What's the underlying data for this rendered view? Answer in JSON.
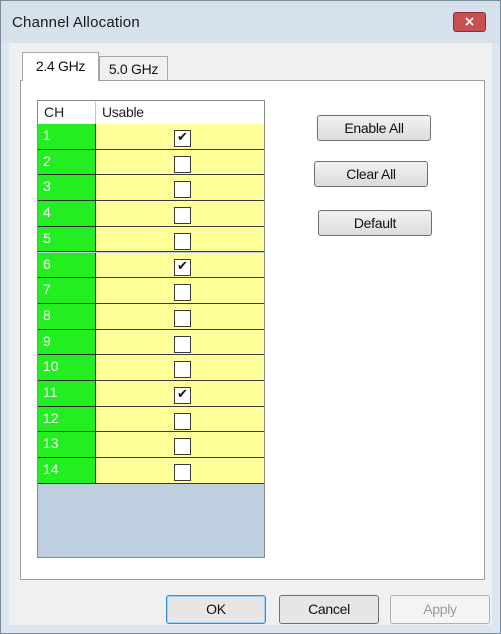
{
  "window": {
    "title": "Channel Allocation",
    "close_glyph": "×"
  },
  "tabs": [
    {
      "label": "2.4 GHz",
      "active": true
    },
    {
      "label": "5.0 GHz",
      "active": false
    }
  ],
  "grid": {
    "headers": {
      "ch": "CH",
      "usable": "Usable"
    },
    "rows": [
      {
        "ch": "1",
        "usable": true
      },
      {
        "ch": "2",
        "usable": false
      },
      {
        "ch": "3",
        "usable": false
      },
      {
        "ch": "4",
        "usable": false
      },
      {
        "ch": "5",
        "usable": false
      },
      {
        "ch": "6",
        "usable": true
      },
      {
        "ch": "7",
        "usable": false
      },
      {
        "ch": "8",
        "usable": false
      },
      {
        "ch": "9",
        "usable": false
      },
      {
        "ch": "10",
        "usable": false
      },
      {
        "ch": "11",
        "usable": true
      },
      {
        "ch": "12",
        "usable": false
      },
      {
        "ch": "13",
        "usable": false
      },
      {
        "ch": "14",
        "usable": false
      }
    ],
    "check_glyph": "✔"
  },
  "buttons": {
    "enable_all": "Enable All",
    "clear_all": "Clear All",
    "default": "Default"
  },
  "footer": {
    "ok": "OK",
    "cancel": "Cancel",
    "apply": "Apply",
    "apply_enabled": false
  },
  "colors": {
    "channel_cell": "#22ee22",
    "usable_cell": "#ffff99",
    "grid_empty": "#bed0e0",
    "close_button": "#c75050"
  }
}
